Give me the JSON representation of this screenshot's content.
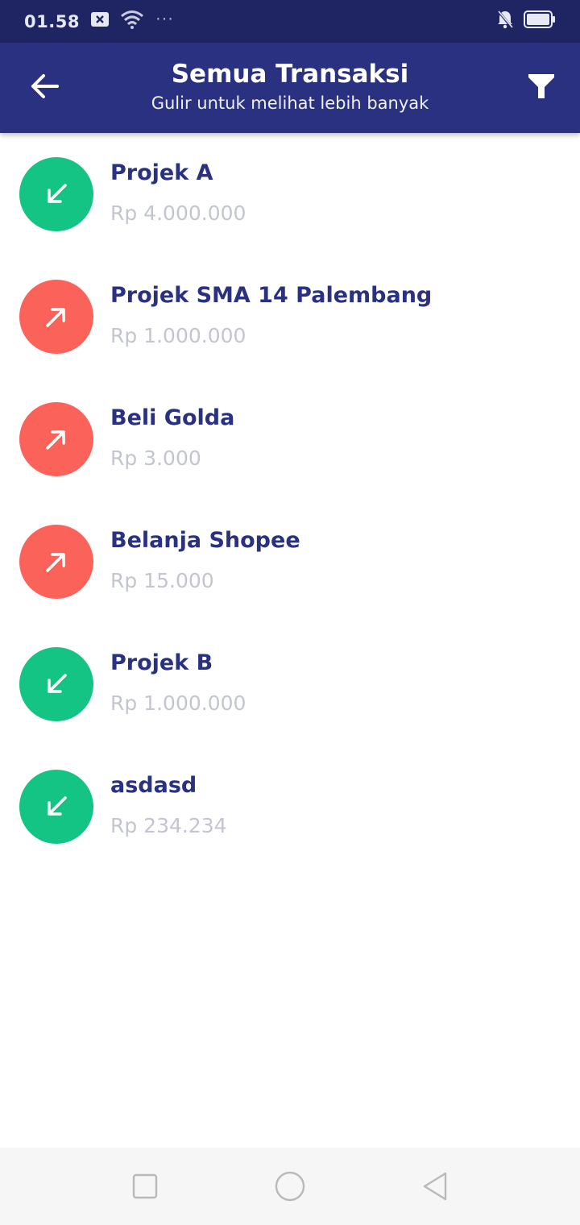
{
  "status_bar": {
    "time": "01.58",
    "dots": "···"
  },
  "header": {
    "title": "Semua Transaksi",
    "subtitle": "Gulir untuk melihat lebih banyak",
    "back_icon": "arrow-left-icon",
    "filter_icon": "filter-funnel-icon",
    "color": "#2a3180"
  },
  "transactions": [
    {
      "name": "Projek A",
      "amount": "Rp 4.000.000",
      "type": "in"
    },
    {
      "name": "Projek SMA 14 Palembang",
      "amount": "Rp 1.000.000",
      "type": "out"
    },
    {
      "name": "Beli Golda",
      "amount": "Rp 3.000",
      "type": "out"
    },
    {
      "name": "Belanja Shopee",
      "amount": "Rp 15.000",
      "type": "out"
    },
    {
      "name": "Projek B",
      "amount": "Rp 1.000.000",
      "type": "in"
    },
    {
      "name": "asdasd",
      "amount": "Rp 234.234",
      "type": "in"
    }
  ],
  "colors": {
    "income": "#14c485",
    "expense": "#fb625a",
    "amount_text": "#c3c5cf"
  },
  "nav": {
    "recent_icon": "square-icon",
    "home_icon": "circle-icon",
    "back_icon": "triangle-back-icon"
  }
}
